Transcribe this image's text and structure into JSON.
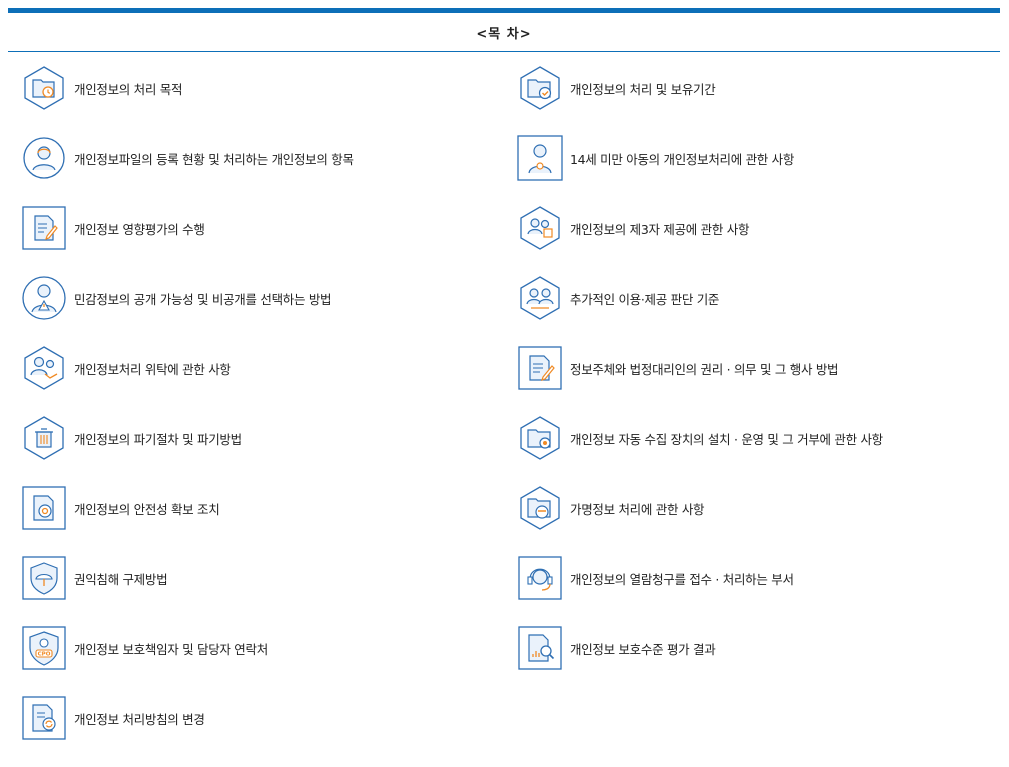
{
  "toc": {
    "title": "<목 차>",
    "accent": "#0d6fb8",
    "items": [
      {
        "label": "개인정보의 처리 목적",
        "icon": "folder-clock-icon"
      },
      {
        "label": "개인정보의 처리 및 보유기간",
        "icon": "folder-check-icon"
      },
      {
        "label": "개인정보파일의 등록 현황 및 처리하는 개인정보의 항목",
        "icon": "user-profile-icon"
      },
      {
        "label": "14세 미만 아동의 개인정보처리에 관한 사항",
        "icon": "child-user-icon"
      },
      {
        "label": "개인정보 영향평가의 수행",
        "icon": "document-edit-icon"
      },
      {
        "label": "개인정보의 제3자 제공에 관한 사항",
        "icon": "users-share-icon"
      },
      {
        "label": "민감정보의 공개 가능성 및 비공개를 선택하는 방법",
        "icon": "user-warning-icon"
      },
      {
        "label": "추가적인 이용·제공 판단 기준",
        "icon": "users-criteria-icon"
      },
      {
        "label": "개인정보처리 위탁에 관한 사항",
        "icon": "users-delegate-icon"
      },
      {
        "label": "정보주체와 법정대리인의 권리 · 의무 및 그 행사 방법",
        "icon": "document-sign-icon"
      },
      {
        "label": "개인정보의 파기절차 및 파기방법",
        "icon": "trash-icon"
      },
      {
        "label": "개인정보 자동 수집 장치의 설치 · 운영 및 그 거부에 관한 사항",
        "icon": "folder-gear-icon"
      },
      {
        "label": "개인정보의 안전성 확보 조치",
        "icon": "document-shield-icon"
      },
      {
        "label": "가명정보 처리에 관한 사항",
        "icon": "folder-mask-icon"
      },
      {
        "label": "권익침해 구제방법",
        "icon": "shield-umbrella-icon"
      },
      {
        "label": "개인정보의 열람청구를 접수 · 처리하는 부서",
        "icon": "headset-icon"
      },
      {
        "label": "개인정보 보호책임자 및 담당자 연락처",
        "icon": "cpo-badge-icon"
      },
      {
        "label": "개인정보 보호수준 평가 결과",
        "icon": "document-search-icon"
      },
      {
        "label": "개인정보 처리방침의 변경",
        "icon": "document-refresh-icon"
      }
    ]
  }
}
